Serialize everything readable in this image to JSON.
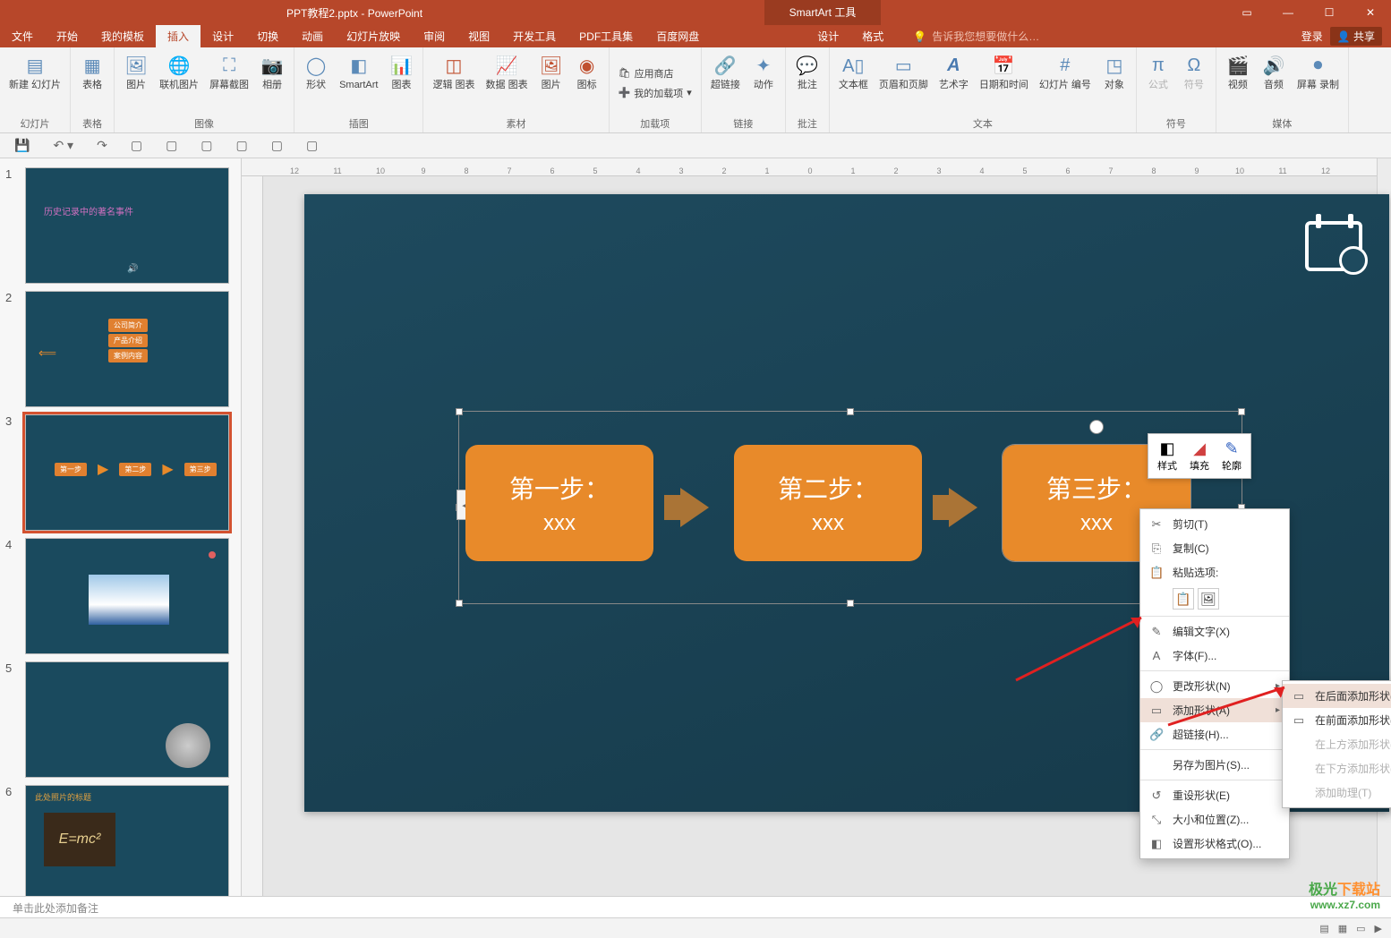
{
  "titlebar": {
    "filename": "PPT教程2.pptx - PowerPoint",
    "tool_tab": "SmartArt 工具",
    "login": "登录",
    "share": "共享"
  },
  "tabs": {
    "file": "文件",
    "home": "开始",
    "tmpl": "我的模板",
    "insert": "插入",
    "design": "设计",
    "trans": "切换",
    "anim": "动画",
    "show": "幻灯片放映",
    "review": "审阅",
    "view": "视图",
    "dev": "开发工具",
    "pdf": "PDF工具集",
    "baidu": "百度网盘",
    "sa_design": "设计",
    "sa_format": "格式",
    "tell_me": "告诉我您想要做什么…"
  },
  "ribbon": {
    "new_slide": "新建\n幻灯片",
    "table": "表格",
    "group_slides": "幻灯片",
    "group_tables": "表格",
    "picture": "图片",
    "online_pic": "联机图片",
    "screenshot": "屏幕截图",
    "album": "相册",
    "group_images": "图像",
    "shapes": "形状",
    "smartart": "SmartArt",
    "chart": "图表",
    "group_illust": "插图",
    "logic_chart": "逻辑\n图表",
    "data_chart": "数据\n图表",
    "pic2": "图片",
    "icon": "图标",
    "group_material": "素材",
    "store": "应用商店",
    "my_addins": "我的加载项",
    "group_addins": "加载项",
    "hyperlink": "超链接",
    "action": "动作",
    "group_links": "链接",
    "comment": "批注",
    "group_comments": "批注",
    "textbox": "文本框",
    "header_footer": "页眉和页脚",
    "wordart": "艺术字",
    "datetime": "日期和时间",
    "slide_num": "幻灯片\n编号",
    "object": "对象",
    "group_text": "文本",
    "equation": "公式",
    "symbol": "符号",
    "group_symbols": "符号",
    "video": "视频",
    "audio": "音频",
    "screen_rec": "屏幕\n录制",
    "group_media": "媒体"
  },
  "thumbs": {
    "s1_title": "历史记录中的著名事件",
    "s2_a": "公司简介",
    "s2_b": "产品介绍",
    "s2_c": "案例内容",
    "s3_a": "第一步",
    "s3_b": "第二步",
    "s3_c": "第三步",
    "s6_title": "此处照片的标题",
    "s6_eq": "E=mc²"
  },
  "slide": {
    "box1_title": "第一步：",
    "box1_sub": "xxx",
    "box2_title": "第二步：",
    "box2_sub": "xxx",
    "box3_title": "第三步：",
    "box3_sub": "xxx"
  },
  "minitb": {
    "style": "样式",
    "fill": "填充",
    "outline": "轮廓"
  },
  "ctx": {
    "cut": "剪切(T)",
    "copy": "复制(C)",
    "paste_opts": "粘贴选项:",
    "edit_text": "编辑文字(X)",
    "font": "字体(F)...",
    "change_shape": "更改形状(N)",
    "add_shape": "添加形状(A)",
    "hyperlink": "超链接(H)...",
    "save_as_pic": "另存为图片(S)...",
    "reset_shape": "重设形状(E)",
    "size_pos": "大小和位置(Z)...",
    "format_shape": "设置形状格式(O)..."
  },
  "submenu": {
    "add_after": "在后面添加形状(A)",
    "add_before": "在前面添加形状(B)",
    "add_above": "在上方添加形状(V)",
    "add_below": "在下方添加形状(W)",
    "add_assist": "添加助理(T)"
  },
  "notes": {
    "placeholder": "单击此处添加备注"
  },
  "watermark": {
    "brand": "极光下载站",
    "url": "www.xz7.com"
  },
  "ruler": [
    "12",
    "11",
    "10",
    "9",
    "8",
    "7",
    "6",
    "5",
    "4",
    "3",
    "2",
    "1",
    "0",
    "1",
    "2",
    "3",
    "4",
    "5",
    "6",
    "7",
    "8",
    "9",
    "10",
    "11",
    "12"
  ]
}
